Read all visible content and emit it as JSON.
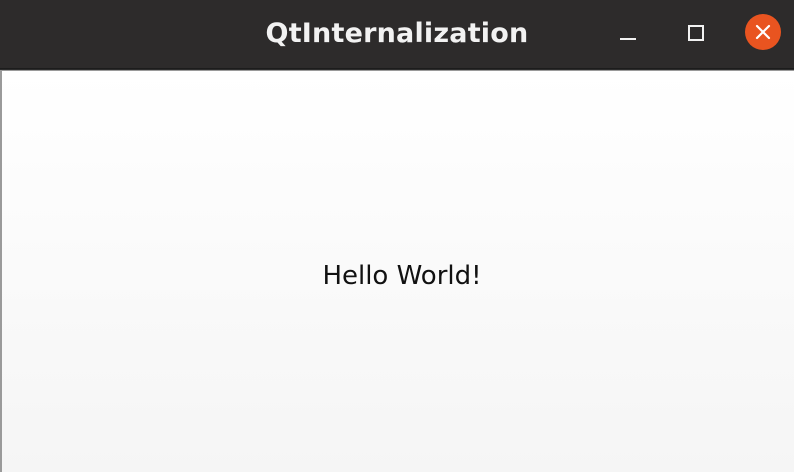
{
  "window": {
    "title": "QtInternalization",
    "controls": {
      "minimize_icon": "minimize-icon",
      "maximize_icon": "maximize-icon",
      "close_icon": "close-icon"
    }
  },
  "main": {
    "label_text": "Hello World!"
  },
  "colors": {
    "titlebar_bg": "#2d2b2b",
    "title_text": "#f2f2f2",
    "close_button": "#e95420",
    "content_bg": "#ffffff"
  }
}
